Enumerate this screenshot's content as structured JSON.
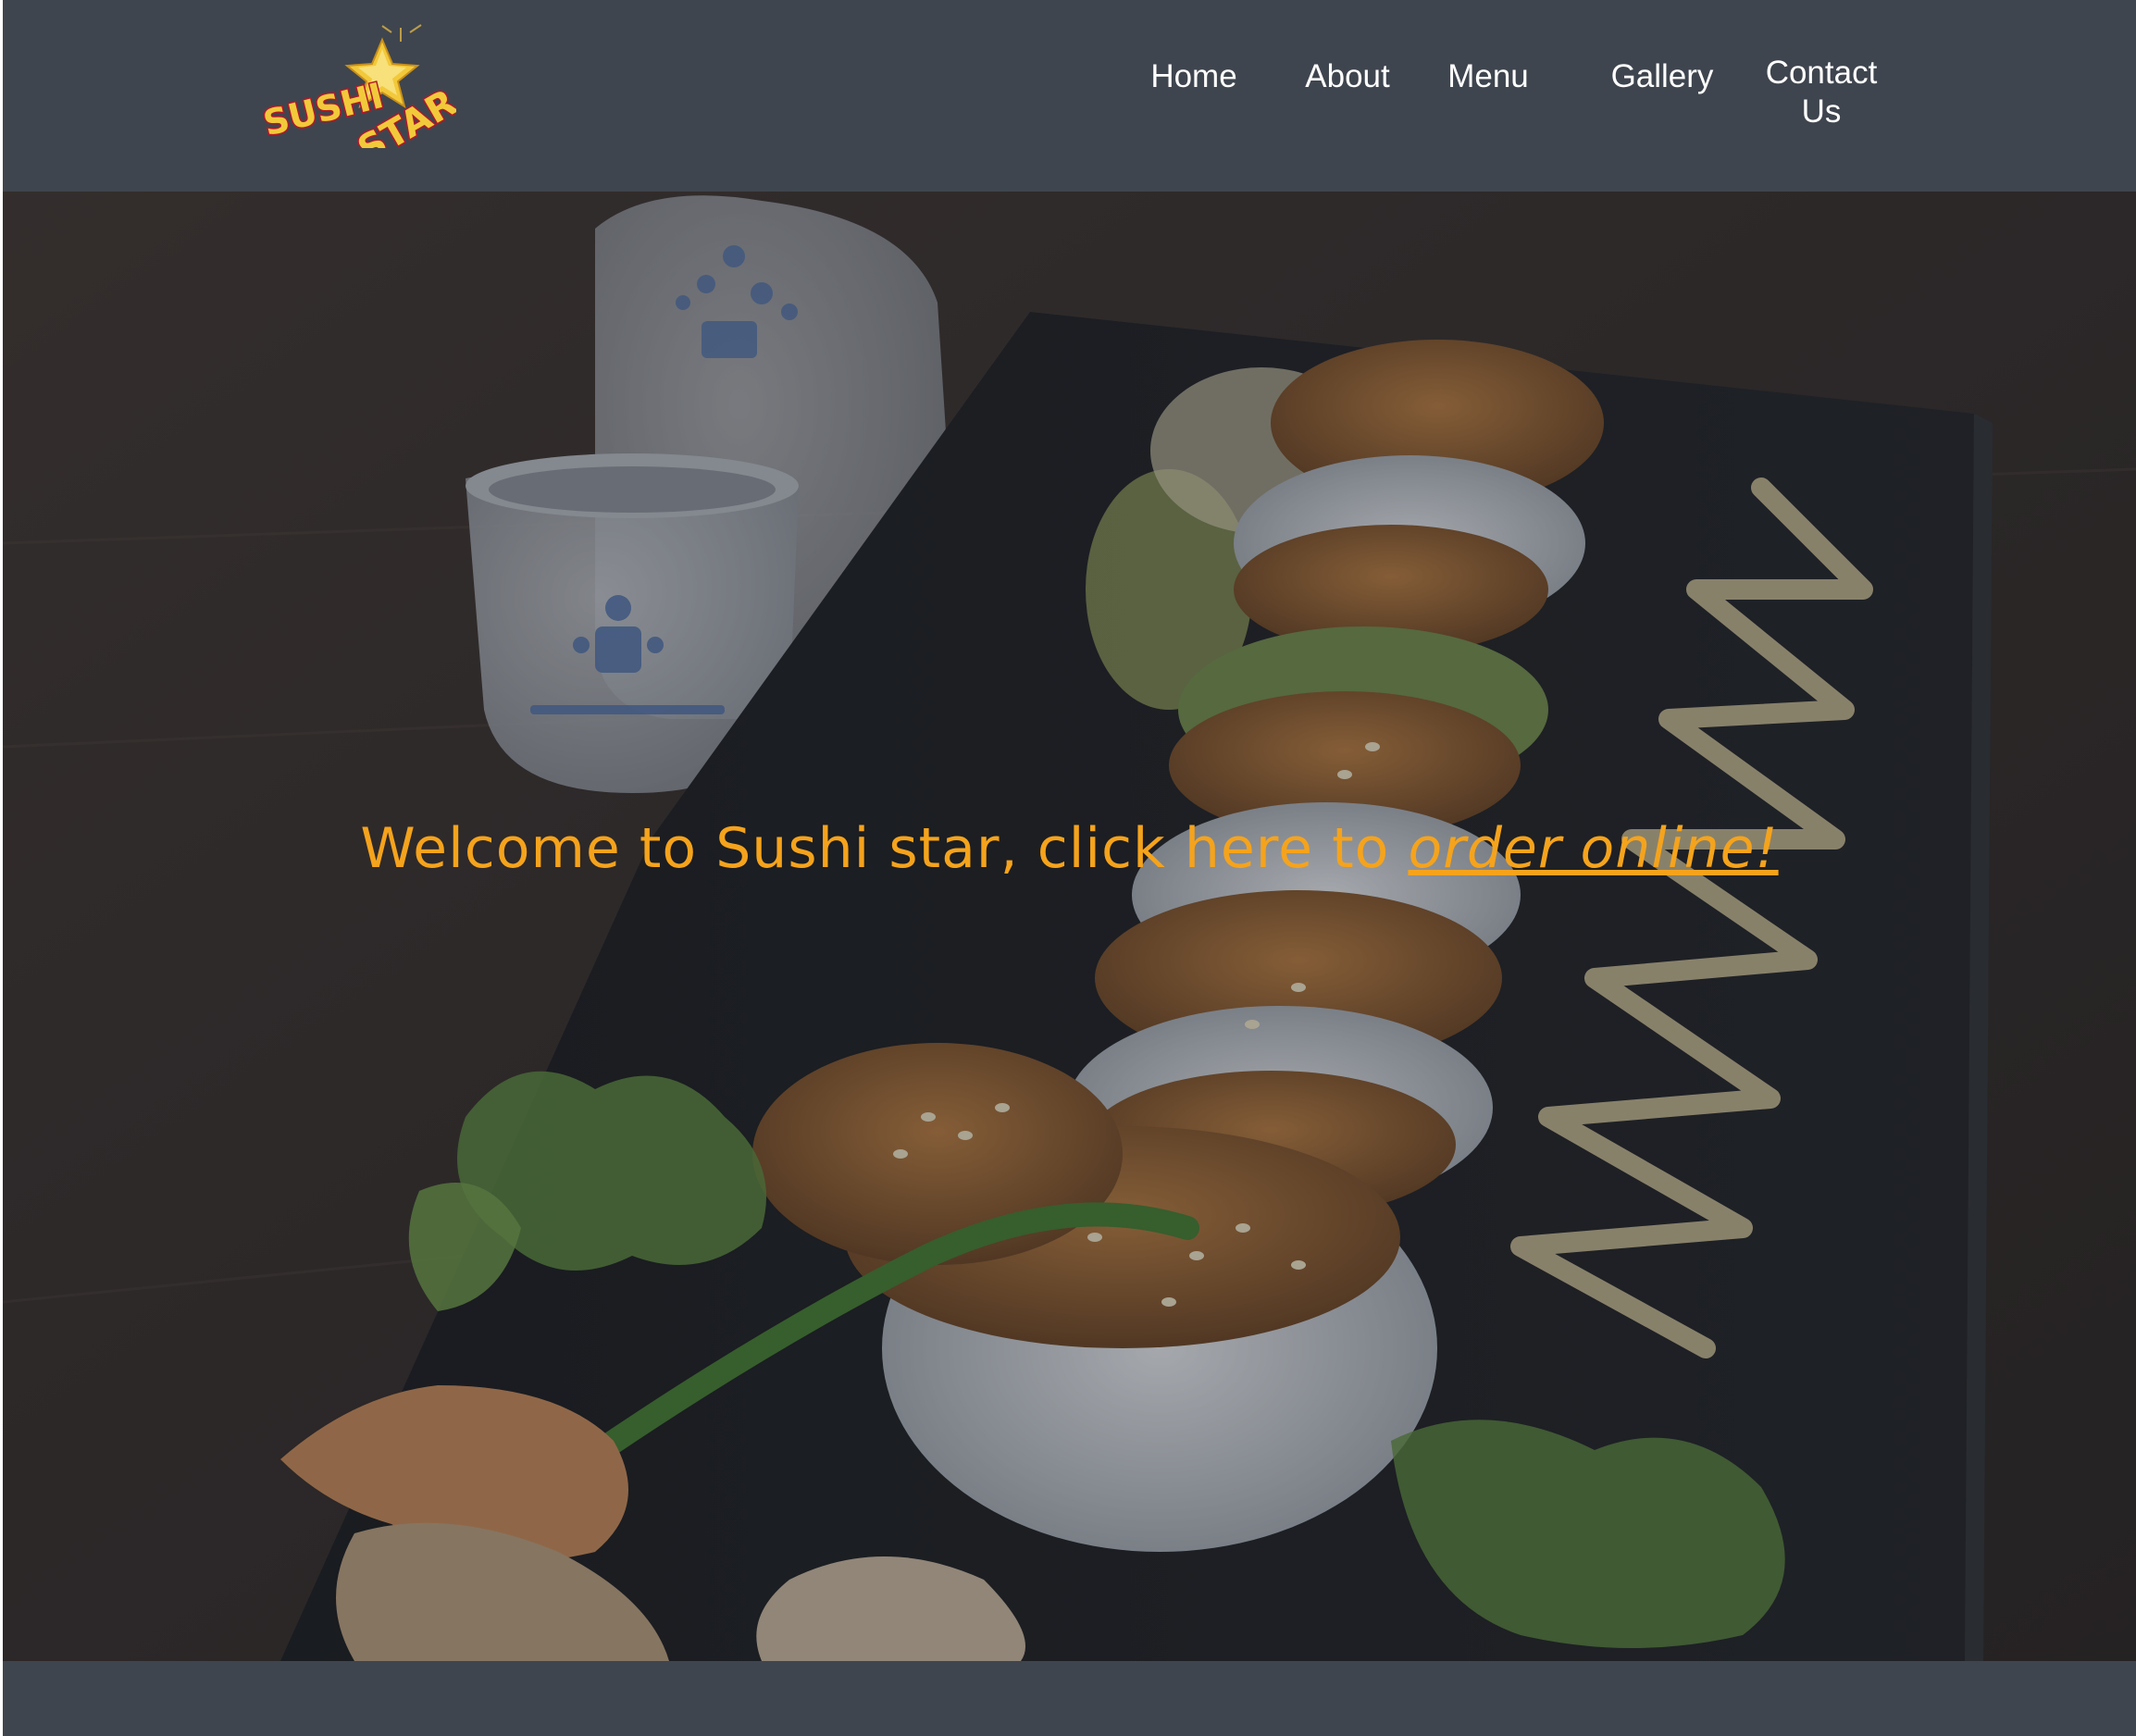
{
  "header": {
    "logo_text_line1": "SUSHI",
    "logo_text_line2": "STAR",
    "nav": {
      "home": "Home",
      "about": "About",
      "menu": "Menu",
      "gallery": "Gallery",
      "contact_line1": "Contact",
      "contact_line2": "Us"
    }
  },
  "hero": {
    "welcome_text": "Welcome to Sushi star, click here to ",
    "order_link": "order online!"
  },
  "colors": {
    "header_bg": "#3f454e",
    "accent": "#f5a31c",
    "nav_text": "#ffffff"
  },
  "icons": {
    "logo": "sushi-star-logo"
  }
}
